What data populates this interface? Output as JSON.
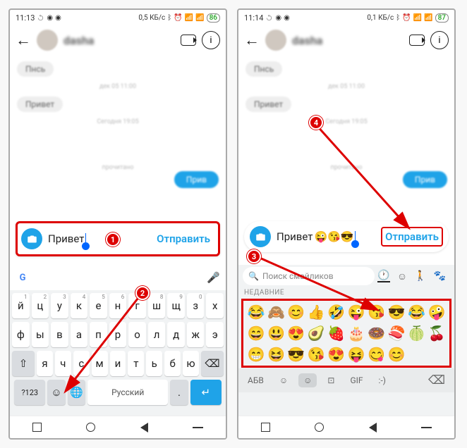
{
  "left": {
    "status": {
      "time": "11:13",
      "data": "0,5 КБ/с",
      "battery": "86"
    },
    "compose": {
      "text": "Привет",
      "send": "Отправить"
    },
    "keyboard": {
      "row1": [
        "й",
        "ц",
        "у",
        "к",
        "е",
        "н",
        "г",
        "ш",
        "щ",
        "з",
        "х"
      ],
      "row1_sup": [
        "1",
        "2",
        "3",
        "4",
        "5",
        "6",
        "7",
        "8",
        "9",
        "0",
        ""
      ],
      "row2": [
        "ф",
        "ы",
        "в",
        "а",
        "п",
        "р",
        "о",
        "л",
        "д",
        "ж",
        "э"
      ],
      "row3": [
        "я",
        "ч",
        "с",
        "м",
        "и",
        "т",
        "ь",
        "б",
        "ю"
      ],
      "shift": "⇧",
      "backspace": "⌫",
      "numkey": "?123",
      "space": "Русский",
      "enter": "↵"
    }
  },
  "right": {
    "status": {
      "time": "11:14",
      "data": "0,1 КБ/с",
      "battery": "87"
    },
    "compose": {
      "text": "Привет",
      "send": "Отправить",
      "emojis": [
        "😜",
        "😘",
        "😎"
      ]
    },
    "emoji_panel": {
      "search_placeholder": "Поиск смайликов",
      "section_label": "НЕДАВНИЕ",
      "rows": [
        [
          "😂",
          "🙈",
          "😊",
          "👍",
          "🤣",
          "😜",
          "😘",
          "😎",
          "😂",
          "🤪"
        ],
        [
          "😄",
          "😃",
          "😍",
          "🥑",
          "🍓",
          "🎂",
          "🍩",
          "🍣",
          "🍈",
          "🍒"
        ],
        [
          "😁",
          "😆",
          "😎",
          "😘",
          "😍",
          "😝",
          "😋",
          "😊",
          "",
          ""
        ]
      ],
      "tabs": {
        "abc": "АБВ",
        "gif": "GIF",
        "ascii": ":-)"
      }
    }
  },
  "steps": {
    "s1": "1",
    "s2": "2",
    "s3": "3",
    "s4": "4"
  }
}
